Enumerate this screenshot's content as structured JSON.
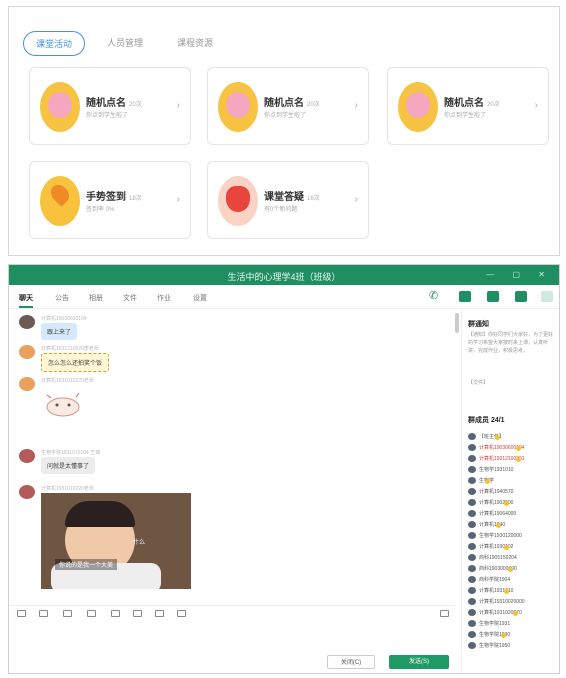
{
  "top": {
    "tabs": [
      {
        "label": "课堂活动",
        "active": true
      },
      {
        "label": "人员管理",
        "active": false
      },
      {
        "label": "课程资源",
        "active": false
      }
    ],
    "cards": [
      {
        "title": "随机点名",
        "count": "20次",
        "sub": "你点到学生啦了",
        "icon": "owl-avatar-icon"
      },
      {
        "title": "随机点名",
        "count": "20次",
        "sub": "你点到学生啦了",
        "icon": "owl-avatar-icon"
      },
      {
        "title": "随机点名",
        "count": "20次",
        "sub": "你点到学生啦了",
        "icon": "owl-avatar-icon"
      },
      {
        "title": "手势签到",
        "count": "18次",
        "sub": "签到率 0%",
        "icon": "location-pin-icon"
      },
      {
        "title": "课堂答疑",
        "count": "16次",
        "sub": "有0个新问题",
        "icon": "fox-avatar-icon"
      }
    ]
  },
  "chat": {
    "title": "生活中的心理学4班（班级）",
    "nav": [
      "聊天",
      "公告",
      "相册",
      "文件",
      "作业",
      "设置"
    ],
    "messages": [
      {
        "meta": "计算机19030600104",
        "text": "跟上来了",
        "style": "blue"
      },
      {
        "meta": "计算机1931210020李老师",
        "text": "怎么怎么还拍笑个饭",
        "style": "yellow"
      },
      {
        "meta": "计算机1931010220老师",
        "text": "",
        "style": "sticker"
      },
      {
        "meta": "生物学院1931010104 王锋",
        "text": "问就是太懂事了",
        "style": "grey"
      },
      {
        "meta": "计算机1931010220老师",
        "text": "",
        "style": "photo"
      }
    ],
    "photo_caption": "你说的是我一个大美",
    "photo_sidecap": "什么",
    "buttons": {
      "close": "关闭(C)",
      "send": "发送(S)"
    },
    "side": {
      "notice_title": "群通知",
      "notice_text": "【通知】你好同学们大家好，为了更好的学习希望大家按时来上课，认真听讲，完成作业，积极思考。",
      "notice_footer": "【文件】",
      "members_title": "群成员 24/1",
      "members": [
        {
          "name": "【班主任】",
          "red": false
        },
        {
          "name": "计算机19030600104",
          "red": true
        },
        {
          "name": "计算机19312100201",
          "red": true
        },
        {
          "name": "生物学1931010",
          "red": false
        },
        {
          "name": "生物学",
          "red": false
        },
        {
          "name": "计算机1940570",
          "red": false
        },
        {
          "name": "计算机1902000",
          "red": false
        },
        {
          "name": "计算机19064000",
          "red": false
        },
        {
          "name": "计算机1940",
          "red": false
        },
        {
          "name": "生物学1930120000",
          "red": false
        },
        {
          "name": "计算机1930102",
          "red": false
        },
        {
          "name": "商科1905150204",
          "red": false
        },
        {
          "name": "商科1903000600",
          "red": false
        },
        {
          "name": "商科学院1904",
          "red": false
        },
        {
          "name": "计算机1931010",
          "red": false
        },
        {
          "name": "计算机19310020000",
          "red": false
        },
        {
          "name": "计算机1931020070",
          "red": false
        },
        {
          "name": "生物学院1931",
          "red": false
        },
        {
          "name": "生物学院1930",
          "red": false
        },
        {
          "name": "生物学院1950",
          "red": false
        }
      ]
    }
  },
  "colors": {
    "accent": "#1f8f62",
    "tab_active": "#4a90e2",
    "member_highlight": "#d23c3c"
  }
}
